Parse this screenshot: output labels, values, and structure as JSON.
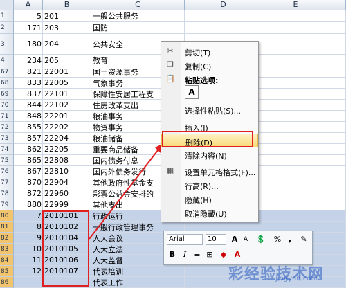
{
  "columns": [
    "A",
    "B",
    "C",
    "D",
    "E"
  ],
  "rows": [
    {
      "num": "1",
      "a": "5",
      "b": "201",
      "c": "一般公共服务",
      "sel": false
    },
    {
      "num": "2",
      "a": "171",
      "b": "203",
      "c": "国防",
      "sel": false
    },
    {
      "num": "3",
      "a": "180",
      "b": "204",
      "c": "公共安全",
      "sel": false
    },
    {
      "num": "4",
      "a": "234",
      "b": "205",
      "c": "教育",
      "sel": false
    },
    {
      "num": "67",
      "a": "821",
      "b": "22001",
      "c": "国土资源事务",
      "sel": false
    },
    {
      "num": "68",
      "a": "833",
      "b": "22005",
      "c": "气象事务",
      "sel": false
    },
    {
      "num": "69",
      "a": "837",
      "b": "22101",
      "c": "保障性安居工程支",
      "sel": false
    },
    {
      "num": "70",
      "a": "844",
      "b": "22102",
      "c": "住房改革支出",
      "sel": false
    },
    {
      "num": "71",
      "a": "848",
      "b": "22201",
      "c": "粮油事务",
      "sel": false
    },
    {
      "num": "72",
      "a": "855",
      "b": "22202",
      "c": "物资事务",
      "sel": false
    },
    {
      "num": "73",
      "a": "857",
      "b": "22204",
      "c": "粮油储备",
      "sel": false
    },
    {
      "num": "74",
      "a": "862",
      "b": "22205",
      "c": "重要商品储备",
      "sel": false
    },
    {
      "num": "75",
      "a": "865",
      "b": "22808",
      "c": "国内债务付息",
      "sel": false
    },
    {
      "num": "76",
      "a": "867",
      "b": "22810",
      "c": "国内外债务发行",
      "sel": false
    },
    {
      "num": "77",
      "a": "870",
      "b": "22904",
      "c": "其他政府性基金支",
      "sel": false
    },
    {
      "num": "78",
      "a": "872",
      "b": "22960",
      "c": "彩票公益金安排的",
      "sel": false
    },
    {
      "num": "79",
      "a": "880",
      "b": "22999",
      "c": "其他支出",
      "sel": false
    },
    {
      "num": "80",
      "a": "7",
      "b": "2010101",
      "c": "  行政运行",
      "sel": true
    },
    {
      "num": "81",
      "a": "8",
      "b": "2010102",
      "c": "  一般行政管理事务",
      "sel": true
    },
    {
      "num": "82",
      "a": "9",
      "b": "2010104",
      "c": "  人大会议",
      "sel": true
    },
    {
      "num": "83",
      "a": "10",
      "b": "2010105",
      "c": "  人大立法",
      "sel": true
    },
    {
      "num": "84",
      "a": "11",
      "b": "2010106",
      "c": "  人大监督",
      "sel": true
    },
    {
      "num": "85",
      "a": "12",
      "b": "2010107",
      "c": "  代表培训",
      "sel": true
    },
    {
      "num": "86",
      "a": "",
      "b": "",
      "c": "  代表工作",
      "sel": true
    }
  ],
  "context_menu": {
    "cut": "剪切(T)",
    "copy": "复制(C)",
    "paste_options": "粘贴选项:",
    "paste_icon": "A",
    "paste_special": "选择性粘贴(S)...",
    "insert": "插入(I)",
    "delete": "删除(D)",
    "clear": "清除内容(N)",
    "format_cells": "设置单元格格式(F)...",
    "row_height": "行高(R)...",
    "hide": "隐藏(H)",
    "unhide": "取消隐藏(U)"
  },
  "mini_toolbar": {
    "font": "Arial",
    "size": "10",
    "grow": "A",
    "shrink": "A",
    "percent": "%",
    "comma": ",",
    "bold": "B",
    "italic": "I"
  },
  "watermark": "彩经验技术网",
  "watermark_sub": "jingyan.com",
  "colors": {
    "highlight": "#f9d976",
    "selection": "#c5d3e8",
    "annotation": "#e02020"
  }
}
